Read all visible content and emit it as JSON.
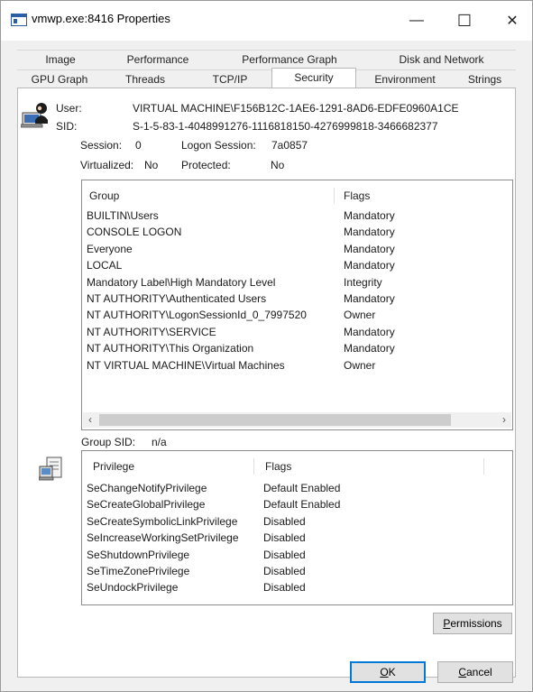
{
  "window": {
    "title": "vmwp.exe:8416 Properties",
    "minimize_glyph": "—",
    "maximize_glyph": "☐",
    "close_glyph": "✕"
  },
  "tabs_top": [
    "Image",
    "Performance",
    "Performance Graph",
    "Disk and Network"
  ],
  "tabs_bottom": [
    "GPU Graph",
    "Threads",
    "TCP/IP",
    "Security",
    "Environment",
    "Strings"
  ],
  "active_tab": "Security",
  "security": {
    "user_label": "User:",
    "user_value": "VIRTUAL MACHINE\\F156B12C-1AE6-1291-8AD6-EDFE0960A1CE",
    "sid_label": "SID:",
    "sid_value": "S-1-5-83-1-4048991276-1116818150-4276999818-3466682377",
    "session_label": "Session:",
    "session_value": "0",
    "logon_session_label": "Logon Session:",
    "logon_session_value": "7a0857",
    "virtualized_label": "Virtualized:",
    "virtualized_value": "No",
    "protected_label": "Protected:",
    "protected_value": "No",
    "group_sid_label": "Group SID:",
    "group_sid_value": "n/a"
  },
  "groups_table": {
    "columns": [
      "Group",
      "Flags"
    ],
    "rows": [
      [
        "BUILTIN\\Users",
        "Mandatory"
      ],
      [
        "CONSOLE LOGON",
        "Mandatory"
      ],
      [
        "Everyone",
        "Mandatory"
      ],
      [
        "LOCAL",
        "Mandatory"
      ],
      [
        "Mandatory Label\\High Mandatory Level",
        "Integrity"
      ],
      [
        "NT AUTHORITY\\Authenticated Users",
        "Mandatory"
      ],
      [
        "NT AUTHORITY\\LogonSessionId_0_7997520",
        "Owner"
      ],
      [
        "NT AUTHORITY\\SERVICE",
        "Mandatory"
      ],
      [
        "NT AUTHORITY\\This Organization",
        "Mandatory"
      ],
      [
        "NT VIRTUAL MACHINE\\Virtual Machines",
        "Owner"
      ]
    ]
  },
  "privileges_table": {
    "columns": [
      "Privilege",
      "Flags"
    ],
    "rows": [
      [
        "SeChangeNotifyPrivilege",
        "Default Enabled"
      ],
      [
        "SeCreateGlobalPrivilege",
        "Default Enabled"
      ],
      [
        "SeCreateSymbolicLinkPrivilege",
        "Disabled"
      ],
      [
        "SeIncreaseWorkingSetPrivilege",
        "Disabled"
      ],
      [
        "SeShutdownPrivilege",
        "Disabled"
      ],
      [
        "SeTimeZonePrivilege",
        "Disabled"
      ],
      [
        "SeUndockPrivilege",
        "Disabled"
      ]
    ]
  },
  "buttons": {
    "permissions_pre": "",
    "permissions_ul": "P",
    "permissions_post": "ermissions",
    "ok_pre": "",
    "ok_ul": "O",
    "ok_post": "K",
    "cancel_pre": "",
    "cancel_ul": "C",
    "cancel_post": "ancel"
  },
  "scrollbar": {
    "left_arrow": "‹",
    "right_arrow": "›"
  },
  "colors": {
    "window_bg": "#f0f0f0",
    "panel_bg": "#ffffff",
    "default_button_border": "#0078d7"
  },
  "icons": [
    "app-window-icon",
    "user-security-icon",
    "privilege-scroll-icon"
  ]
}
